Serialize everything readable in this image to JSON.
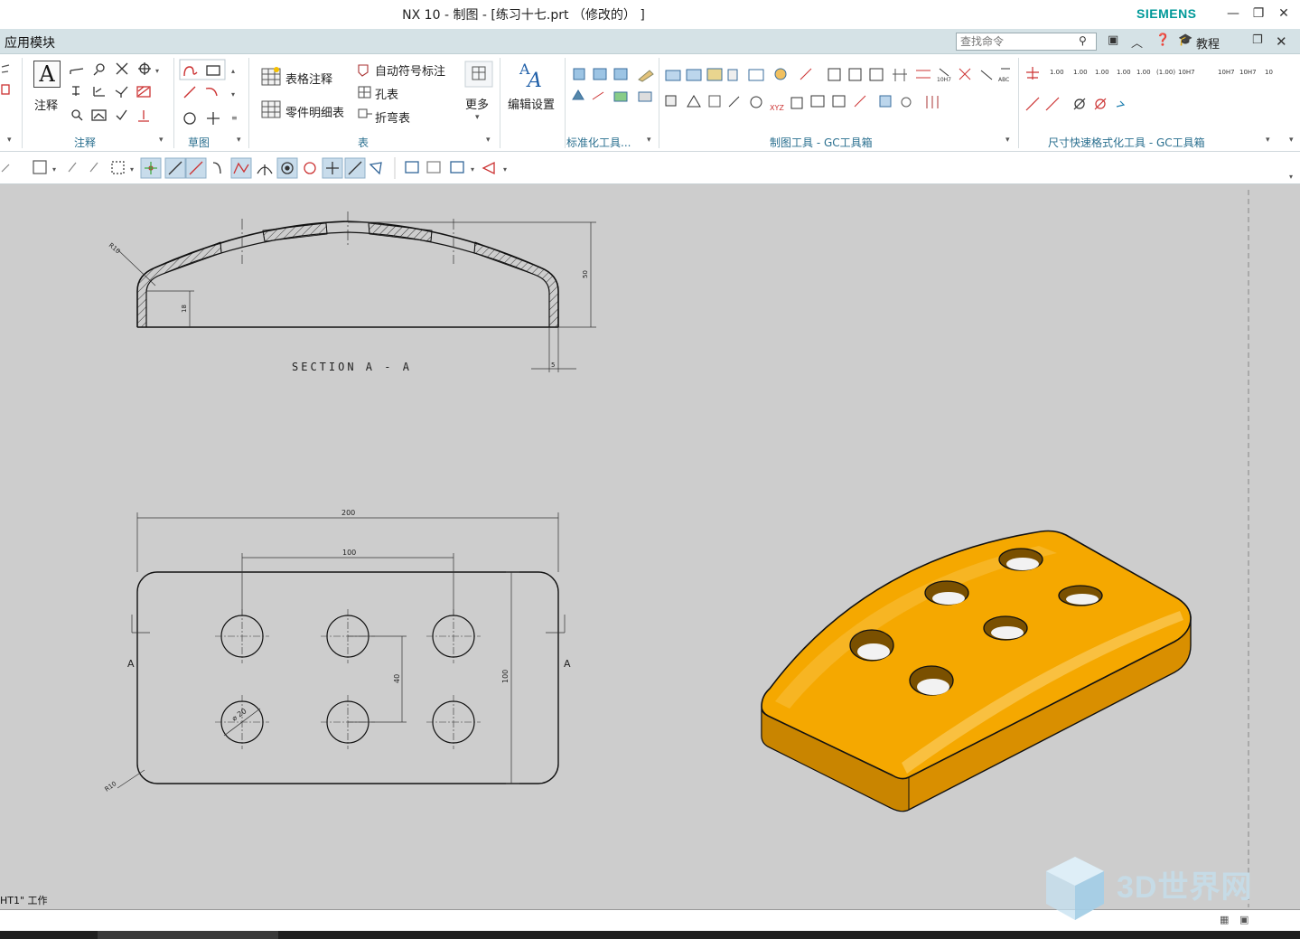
{
  "window": {
    "title": "NX 10 - 制图 - [练习十七.prt （修改的） ]",
    "brand": "SIEMENS",
    "minimize": "🗕",
    "restore": "🗗",
    "close": "✕"
  },
  "menubar": {
    "app_menu": "应用模块",
    "search_placeholder": "查找命令",
    "tutorial": "教程"
  },
  "ribbon": {
    "groups": {
      "annotation": "注释",
      "sketch": "草图",
      "table": "表",
      "std_tools": "标准化工具...",
      "drafting_tools": "制图工具 - GC工具箱",
      "dim_format_tools": "尺寸快速格式化工具 - GC工具箱"
    },
    "annotation_label": "注释",
    "table_note": "表格注释",
    "parts_list": "零件明细表",
    "auto_balloon": "自动符号标注",
    "hole_table": "孔表",
    "bend_table": "折弯表",
    "more": "更多",
    "edit_settings": "编辑设置",
    "dim_formats": [
      "1.00",
      "1.00",
      "1.00",
      "1.00",
      "1.00",
      "(1.00)",
      "10H7",
      "10H7",
      "10H7",
      "10"
    ]
  },
  "drawing": {
    "section_label": "SECTION  A - A",
    "section_dims": {
      "radius": "R10",
      "height": "50",
      "inner_height": "18",
      "thickness": "5"
    },
    "plan_dims": {
      "overall_width": "200",
      "hole_spacing": "100",
      "row_spacing": "40",
      "overall_height": "100",
      "hole_dia": "⌀ 20",
      "corner_radius": "R10"
    },
    "cut_label_left": "A",
    "cut_label_right": "A"
  },
  "status": {
    "sheet_text": "HT1\" 工作"
  },
  "watermark": {
    "text": "3D世界网"
  },
  "colors": {
    "part_fill": "#f5a800",
    "part_dark": "#d98f00",
    "canvas_bg": "#cdcdcd",
    "group_label": "#2a6f8f",
    "brand": "#009999"
  }
}
